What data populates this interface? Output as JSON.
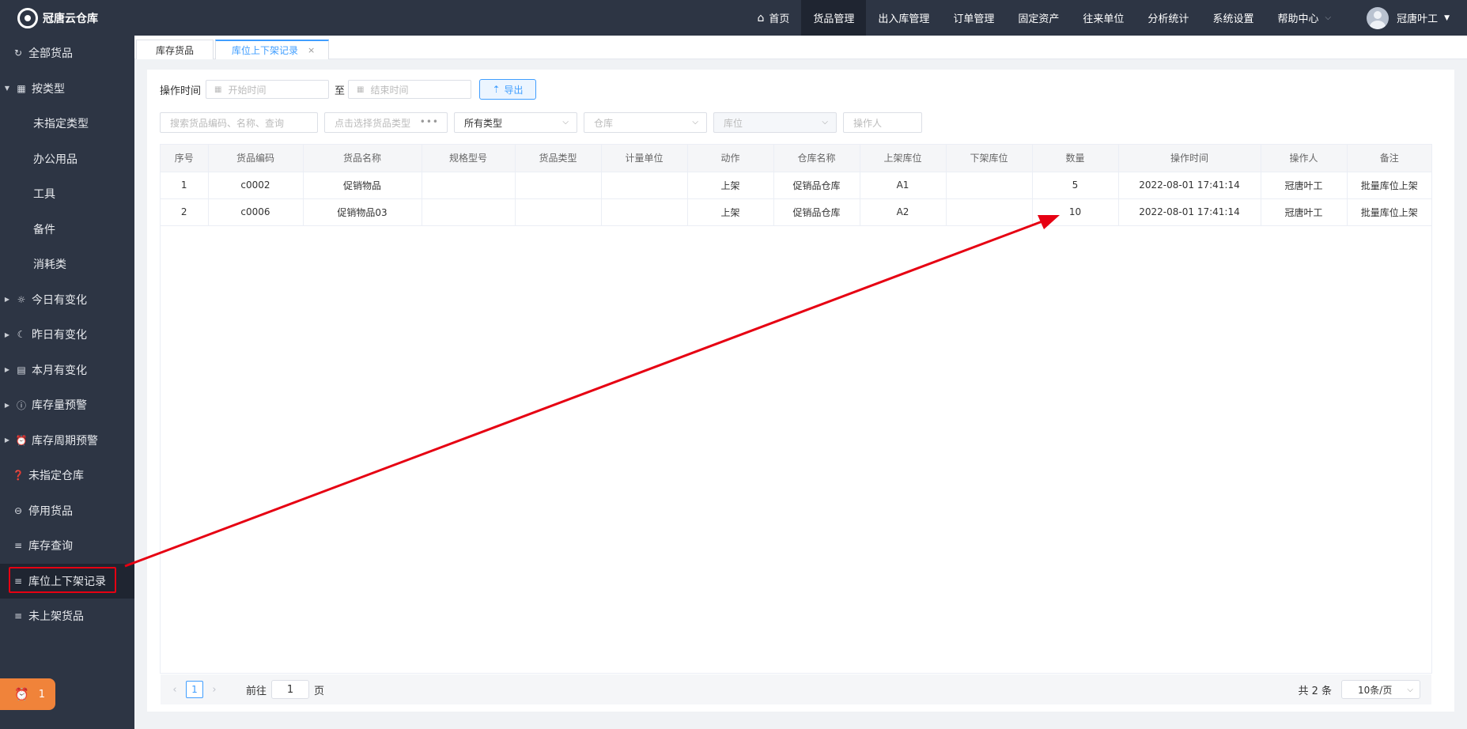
{
  "app": {
    "title": "冠唐云仓库"
  },
  "sidebar": {
    "items": [
      {
        "label": "全部货品",
        "icon": "refresh-icon",
        "glyph": "↻",
        "type": "top"
      },
      {
        "label": "按类型",
        "icon": "grid-icon",
        "glyph": "▦",
        "type": "group"
      },
      {
        "label": "未指定类型",
        "type": "sub"
      },
      {
        "label": "办公用品",
        "type": "sub"
      },
      {
        "label": "工具",
        "type": "sub"
      },
      {
        "label": "备件",
        "type": "sub"
      },
      {
        "label": "消耗类",
        "type": "sub"
      },
      {
        "label": "今日有变化",
        "icon": "sun-icon",
        "glyph": "☼",
        "type": "collapsed"
      },
      {
        "label": "昨日有变化",
        "icon": "moon-icon",
        "glyph": "☾",
        "type": "collapsed"
      },
      {
        "label": "本月有变化",
        "icon": "calendar-icon",
        "glyph": "▤",
        "type": "collapsed"
      },
      {
        "label": "库存量预警",
        "icon": "alert-icon",
        "glyph": "ⓘ",
        "type": "collapsed"
      },
      {
        "label": "库存周期预警",
        "icon": "clock-icon",
        "glyph": "⏰",
        "type": "collapsed"
      },
      {
        "label": "未指定仓库",
        "icon": "question-icon",
        "glyph": "❓",
        "type": "top"
      },
      {
        "label": "停用货品",
        "icon": "minus-circle-icon",
        "glyph": "⊖",
        "type": "top"
      },
      {
        "label": "库存查询",
        "icon": "list-icon",
        "glyph": "≡",
        "type": "top"
      },
      {
        "label": "库位上下架记录",
        "icon": "list-icon",
        "glyph": "≡",
        "type": "top",
        "active": true
      },
      {
        "label": "未上架货品",
        "icon": "list-icon",
        "glyph": "≡",
        "type": "top"
      }
    ],
    "alarm_count": "1"
  },
  "topbar": {
    "menu": [
      {
        "label": "首页",
        "icon": "home-icon"
      },
      {
        "label": "货品管理",
        "active": true
      },
      {
        "label": "出入库管理"
      },
      {
        "label": "订单管理"
      },
      {
        "label": "固定资产"
      },
      {
        "label": "往来单位"
      },
      {
        "label": "分析统计"
      },
      {
        "label": "系统设置"
      },
      {
        "label": "帮助中心",
        "dropdown": true
      }
    ],
    "user": "冠唐叶工"
  },
  "tabs": [
    {
      "label": "库存货品"
    },
    {
      "label": "库位上下架记录",
      "active": true,
      "close": "×"
    }
  ],
  "filters": {
    "op_time_label": "操作时间",
    "start_placeholder": "开始时间",
    "to_label": "至",
    "end_placeholder": "结束时间",
    "export_label": "导出",
    "search_placeholder": "搜索货品编码、名称、查询",
    "type_picker_placeholder": "点击选择货品类型",
    "all_types": "所有类型",
    "warehouse_placeholder": "仓库",
    "location_placeholder": "库位",
    "operator_placeholder": "操作人"
  },
  "table": {
    "columns": [
      "序号",
      "货品编码",
      "货品名称",
      "规格型号",
      "货品类型",
      "计量单位",
      "动作",
      "仓库名称",
      "上架库位",
      "下架库位",
      "数量",
      "操作时间",
      "操作人",
      "备注"
    ],
    "rows": [
      [
        "1",
        "c0002",
        "促销物品",
        "",
        "",
        "",
        "上架",
        "促销品仓库",
        "A1",
        "",
        "5",
        "2022-08-01 17:41:14",
        "冠唐叶工",
        "批量库位上架"
      ],
      [
        "2",
        "c0006",
        "促销物品03",
        "",
        "",
        "",
        "上架",
        "促销品仓库",
        "A2",
        "",
        "10",
        "2022-08-01 17:41:14",
        "冠唐叶工",
        "批量库位上架"
      ]
    ]
  },
  "pagination": {
    "current_page": "1",
    "goto_prefix": "前往",
    "goto_value": "1",
    "goto_suffix": "页",
    "total": "共 2 条",
    "page_size": "10条/页"
  },
  "colors": {
    "sidebar_bg": "#2d3544",
    "accent": "#409eff",
    "annotation": "#e60012",
    "alarm": "#f0833a"
  }
}
